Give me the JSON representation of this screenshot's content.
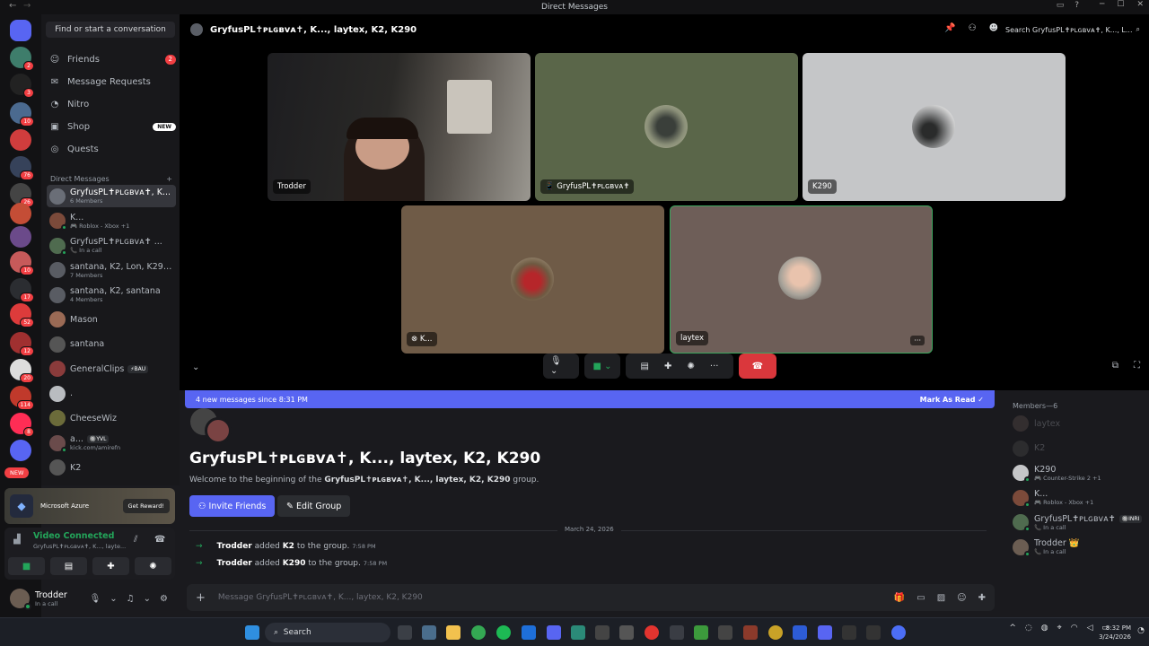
{
  "window": {
    "title": "Direct Messages"
  },
  "guilds": [
    {
      "badge": "2"
    },
    {
      "badge": "3"
    },
    {
      "badge": "10"
    },
    {
      "badge": ""
    },
    {
      "badge": "76"
    },
    {
      "badge": "26"
    },
    {
      "badge": ""
    },
    {
      "badge": ""
    },
    {
      "badge": "10"
    },
    {
      "badge": "17"
    },
    {
      "badge": "52"
    },
    {
      "badge": "12"
    },
    {
      "badge": "20"
    },
    {
      "badge": "114"
    },
    {
      "badge": "8"
    },
    {
      "badge": ""
    }
  ],
  "guild_new_label": "NEW",
  "sidebar": {
    "find_label": "Find or start a conversation",
    "friends": {
      "label": "Friends",
      "badge": "2"
    },
    "message_requests": "Message Requests",
    "nitro": "Nitro",
    "shop": {
      "label": "Shop",
      "badge": "NEW"
    },
    "quests": "Quests",
    "dm_header": "Direct Messages",
    "dm_add": "+",
    "dms": [
      {
        "name": "GryfusPL✝ᴘʟɢʙᴠᴀ✝, K...",
        "sub": "6 Members",
        "selected": true
      },
      {
        "name": "K...",
        "sub": "🎮 Roblox - Xbox +1"
      },
      {
        "name": "GryfusPL✝ᴘʟɢʙᴠᴀ✝ ...",
        "sub": "📞 In a call"
      },
      {
        "name": "santana, K2, Lon, K290,...",
        "sub": "7 Members"
      },
      {
        "name": "santana, K2, santana",
        "sub": "4 Members"
      },
      {
        "name": "Mason",
        "sub": ""
      },
      {
        "name": "santana",
        "sub": ""
      },
      {
        "name": "GeneralClips",
        "sub": "",
        "tag": "⚡BAU"
      },
      {
        "name": ".",
        "sub": ""
      },
      {
        "name": "CheeseWiz",
        "sub": ""
      },
      {
        "name": "a...",
        "sub": "kick.com/amirefn",
        "tag": "🔘YVL"
      },
      {
        "name": "K2",
        "sub": ""
      }
    ]
  },
  "promo": {
    "title": "Microsoft Azure",
    "button": "Get Reward!"
  },
  "voice": {
    "status": "Video Connected",
    "channel": "GryfusPL✝ᴘʟɢʙᴠᴀ✝, K..., layte..."
  },
  "user": {
    "name": "Trodder",
    "status": "In a call"
  },
  "header": {
    "title": "GryfusPL✝ᴘʟɢʙᴠᴀ✝, K..., laytex, K2, K290",
    "search_placeholder": "Search GryfusPL✝ᴘʟɢʙᴠᴀ✝, K..., L..."
  },
  "tiles": [
    {
      "label": "Trodder"
    },
    {
      "label": "📱 GryfusPL✝ᴘʟɢʙᴠᴀ✝"
    },
    {
      "label": "K290"
    },
    {
      "label": "K..."
    },
    {
      "label": "laytex"
    }
  ],
  "chat": {
    "new_messages": "4 new messages since 8:31 PM",
    "mark_read": "Mark As Read",
    "title": "GryfusPL✝ᴘʟɢʙᴠᴀ✝, K..., laytex, K2, K290",
    "welcome_pre": "Welcome to the beginning of the ",
    "welcome_group": "GryfusPL✝ᴘʟɢʙᴠᴀ✝, K..., laytex, K2, K290",
    "welcome_post": " group.",
    "invite": "Invite Friends",
    "edit": "Edit Group",
    "date": "March 24, 2026",
    "messages": [
      {
        "actor": "Trodder",
        "verb": "added",
        "target": "K2",
        "rest": "to the group.",
        "time": "7:58 PM"
      },
      {
        "actor": "Trodder",
        "verb": "added",
        "target": "K290",
        "rest": "to the group.",
        "time": "7:58 PM"
      }
    ],
    "placeholder": "Message GryfusPL✝ᴘʟɢʙᴠᴀ✝, K..., laytex, K2, K290"
  },
  "members": {
    "header": "Members—6",
    "list": [
      {
        "name": "laytex",
        "sub": "",
        "dim": true
      },
      {
        "name": "K2",
        "sub": "",
        "dim": true
      },
      {
        "name": "K290",
        "sub": "🎮 Counter-Strike 2 +1"
      },
      {
        "name": "K...",
        "sub": "🎮 Roblox - Xbox +1"
      },
      {
        "name": "GryfusPL✝ᴘʟɢʙᴠᴀ✝",
        "sub": "📞 In a call",
        "tag": "🔘INRI"
      },
      {
        "name": "Trodder 👑",
        "sub": "📞 In a call"
      }
    ]
  },
  "taskbar": {
    "search": "Search",
    "time": "8:32 PM",
    "date": "3/24/2026"
  }
}
